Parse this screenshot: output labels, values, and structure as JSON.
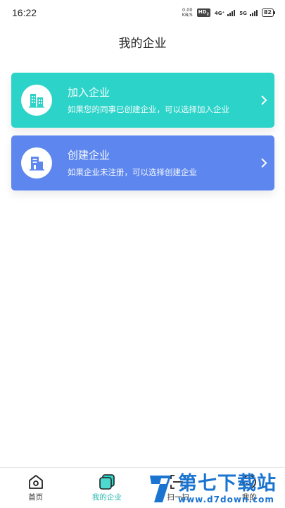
{
  "status_bar": {
    "time": "16:22",
    "net_speed_value": "0.00",
    "net_speed_unit": "KB/S",
    "hd_label": "HD",
    "hd_sub": "2",
    "signal1_label": "4G⁺",
    "signal2_label": "5G",
    "battery": "82"
  },
  "header": {
    "title": "我的企业"
  },
  "cards": [
    {
      "title": "加入企业",
      "subtitle": "如果您的同事已创建企业，可以选择加入企业",
      "color": "#2cd3c9",
      "icon": "building-icon"
    },
    {
      "title": "创建企业",
      "subtitle": "如果企业未注册，可以选择创建企业",
      "color": "#5d87ee",
      "icon": "office-icon"
    }
  ],
  "tabs": [
    {
      "label": "首页",
      "icon": "home-icon"
    },
    {
      "label": "我的企业",
      "icon": "enterprise-icon",
      "active": true
    },
    {
      "label": "扫一扫",
      "icon": "scan-icon"
    },
    {
      "label": "我的",
      "icon": "profile-icon"
    }
  ],
  "watermark": {
    "text": "第七下载站",
    "url": "www.d7down.com"
  },
  "colors": {
    "join": "#2cd3c9",
    "create": "#5d87ee",
    "tab_active": "#26b7ae",
    "watermark": "#1a74d0"
  }
}
